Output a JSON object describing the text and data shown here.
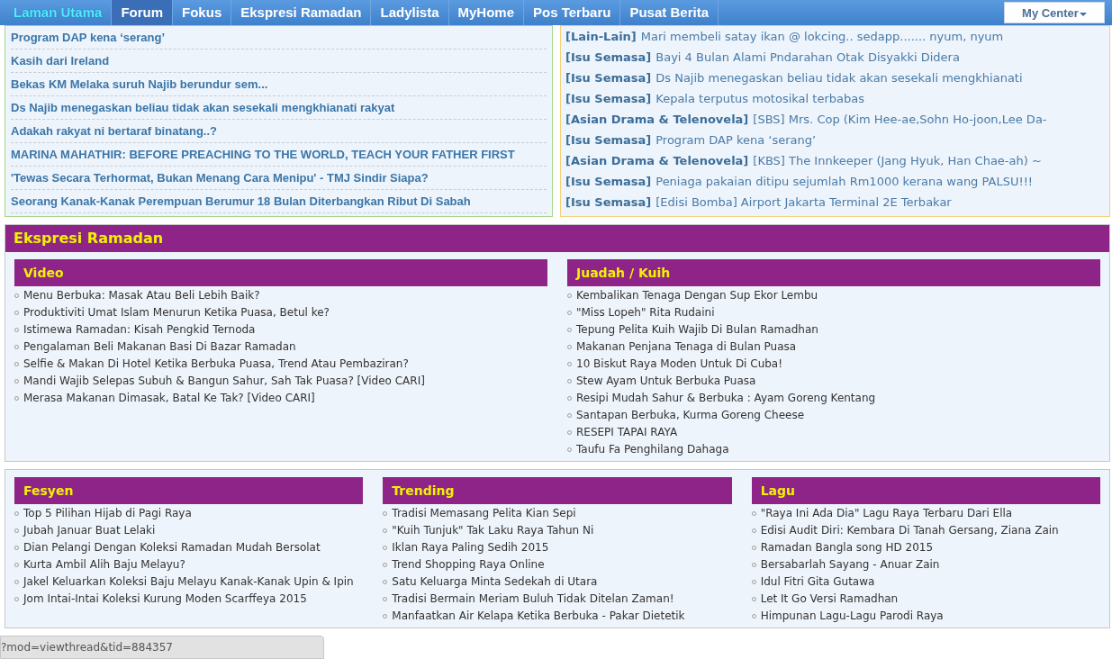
{
  "nav": {
    "items": [
      {
        "label": "Laman Utama",
        "selected": true,
        "hovered": false
      },
      {
        "label": "Forum",
        "selected": false,
        "hovered": true
      },
      {
        "label": "Fokus",
        "selected": false,
        "hovered": false
      },
      {
        "label": "Ekspresi Ramadan",
        "selected": false,
        "hovered": false
      },
      {
        "label": "Ladylista",
        "selected": false,
        "hovered": false
      },
      {
        "label": "MyHome",
        "selected": false,
        "hovered": false
      },
      {
        "label": "Pos Terbaru",
        "selected": false,
        "hovered": false
      },
      {
        "label": "Pusat Berita",
        "selected": false,
        "hovered": false
      }
    ],
    "my_center": {
      "label": "My Center"
    }
  },
  "latest_threads": [
    "Program DAP kena ‘serang’",
    "Kasih dari Ireland",
    "Bekas KM Melaka suruh Najib berundur sem...",
    "Ds Najib menegaskan beliau tidak akan sesekali mengkhianati rakyat",
    "Adakah rakyat ni bertaraf binatang..?",
    "MARINA MAHATHIR: BEFORE PREACHING TO THE WORLD, TEACH YOUR FATHER FIRST",
    "'Tewas Secara Terhormat, Bukan Menang Cara Menipu' - TMJ Sindir Siapa?",
    "Seorang Kanak-Kanak Perempuan Berumur 18 Bulan Diterbangkan Ribut Di Sabah"
  ],
  "latest_posts": [
    {
      "category": "[Lain-Lain]",
      "title": "Mari membeli satay ikan @ lokcing.. sedapp....... nyum, nyum"
    },
    {
      "category": "[Isu Semasa]",
      "title": "Bayi 4 Bulan Alami Pndarahan Otak Disyakki Didera"
    },
    {
      "category": "[Isu Semasa]",
      "title": "Ds Najib menegaskan beliau tidak akan sesekali mengkhianati"
    },
    {
      "category": "[Isu Semasa]",
      "title": "Kepala terputus motosikal terbabas"
    },
    {
      "category": "[Asian Drama & Telenovela]",
      "title": "[SBS] Mrs. Cop (Kim Hee-ae,Sohn Ho-joon,Lee Da-"
    },
    {
      "category": "[Isu Semasa]",
      "title": "Program DAP kena ‘serang’"
    },
    {
      "category": "[Asian Drama & Telenovela]",
      "title": "[KBS] The Innkeeper (Jang Hyuk, Han Chae-ah) ~"
    },
    {
      "category": "[Isu Semasa]",
      "title": "Peniaga pakaian ditipu sejumlah Rm1000 kerana wang PALSU!!!"
    },
    {
      "category": "[Isu Semasa]",
      "title": "[Edisi Bomba] Airport Jakarta Terminal 2E Terbakar"
    }
  ],
  "ramadan_panel": {
    "title": "Ekspresi Ramadan",
    "sections": [
      {
        "title": "Video",
        "items": [
          "Menu Berbuka: Masak Atau Beli Lebih Baik?",
          "Produktiviti Umat Islam Menurun Ketika Puasa, Betul ke?",
          "Istimewa Ramadan: Kisah Pengkid Ternoda",
          "Pengalaman Beli Makanan Basi Di Bazar Ramadan",
          "Selfie & Makan Di Hotel Ketika Berbuka Puasa, Trend Atau Pembaziran?",
          "Mandi Wajib Selepas Subuh & Bangun Sahur, Sah Tak Puasa? [Video CARI]",
          "Merasa Makanan Dimasak, Batal Ke Tak? [Video CARI]"
        ]
      },
      {
        "title": "Juadah / Kuih",
        "items": [
          "Kembalikan Tenaga Dengan Sup Ekor Lembu",
          "\"Miss Lopeh\" Rita Rudaini",
          "Tepung Pelita Kuih Wajib Di Bulan Ramadhan",
          "Makanan Penjana Tenaga di Bulan Puasa",
          "10 Biskut Raya Moden Untuk Di Cuba!",
          "Stew Ayam Untuk Berbuka Puasa",
          "Resipi Mudah Sahur & Berbuka : Ayam Goreng Kentang",
          "Santapan Berbuka, Kurma Goreng Cheese",
          "RESEPI TAPAI RAYA",
          "Taufu Fa Penghilang Dahaga"
        ]
      }
    ]
  },
  "lifestyle_panel": {
    "sections": [
      {
        "title": "Fesyen",
        "items": [
          "Top 5 Pilihan Hijab di Pagi Raya",
          "Jubah Januar Buat Lelaki",
          "Dian Pelangi Dengan Koleksi Ramadan Mudah Bersolat",
          "Kurta Ambil Alih Baju Melayu?",
          "Jakel Keluarkan Koleksi Baju Melayu Kanak-Kanak Upin & Ipin",
          "Jom Intai-Intai Koleksi Kurung Moden Scarffeya 2015"
        ]
      },
      {
        "title": "Trending",
        "items": [
          "Tradisi Memasang Pelita Kian Sepi",
          "\"Kuih Tunjuk\" Tak Laku Raya Tahun Ni",
          "Iklan Raya Paling Sedih 2015",
          "Trend Shopping Raya Online",
          "Satu Keluarga Minta Sedekah di Utara",
          "Tradisi Bermain Meriam Buluh Tidak Ditelan Zaman!",
          "Manfaatkan Air Kelapa Ketika Berbuka - Pakar Dietetik"
        ]
      },
      {
        "title": "Lagu",
        "items": [
          "\"Raya Ini Ada Dia\" Lagu Raya Terbaru Dari Ella",
          "Edisi Audit Diri: Kembara Di Tanah Gersang, Ziana Zain",
          "Ramadan Bangla song HD 2015",
          "Bersabarlah Sayang - Anuar Zain",
          "Idul Fitri Gita Gutawa",
          "Let It Go Versi Ramadhan",
          "Himpunan Lagu-Lagu Parodi Raya"
        ]
      }
    ]
  },
  "status_bar": {
    "url": "?mod=viewthread&tid=884357"
  }
}
